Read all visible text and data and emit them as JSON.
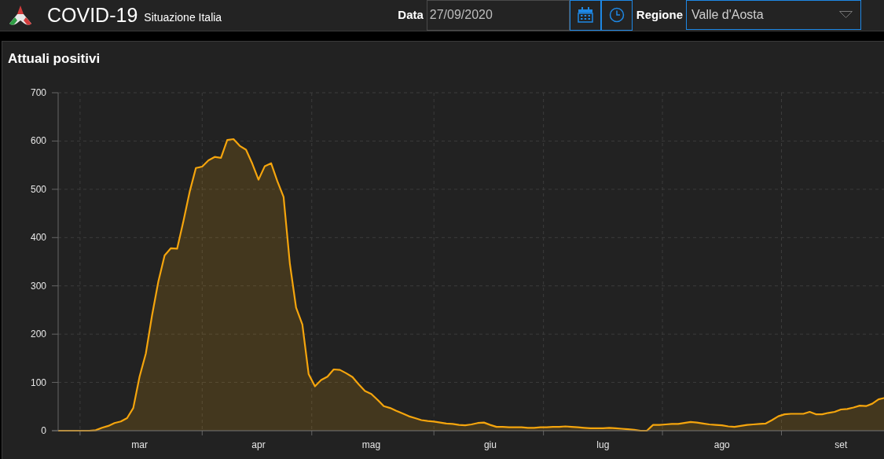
{
  "header": {
    "title": "COVID-19",
    "subtitle": "Situazione Italia"
  },
  "filters": {
    "date_label": "Data",
    "date_value": "27/09/2020",
    "region_label": "Regione",
    "region_value": "Valle d'Aosta"
  },
  "panel": {
    "title": "Attuali positivi",
    "chart_data": {
      "type": "area",
      "categories": [
        null,
        null,
        null,
        null,
        null,
        null,
        null,
        null,
        null,
        null,
        null,
        null,
        null,
        "mar",
        null,
        null,
        null,
        null,
        null,
        null,
        null,
        null,
        null,
        null,
        null,
        null,
        null,
        null,
        null,
        null,
        null,
        null,
        "apr",
        null,
        null,
        null,
        null,
        null,
        null,
        null,
        null,
        null,
        null,
        null,
        null,
        null,
        null,
        null,
        null,
        null,
        "mag",
        null,
        null,
        null,
        null,
        null,
        null,
        null,
        null,
        null,
        null,
        null,
        null,
        null,
        null,
        null,
        null,
        null,
        null,
        "giu",
        null,
        null,
        null,
        null,
        null,
        null,
        null,
        null,
        null,
        null,
        null,
        null,
        null,
        null,
        null,
        null,
        null,
        "lug",
        null,
        null,
        null,
        null,
        null,
        null,
        null,
        null,
        null,
        null,
        null,
        null,
        null,
        null,
        null,
        null,
        null,
        null,
        "ago",
        null,
        null,
        null,
        null,
        null,
        null,
        null,
        null,
        null,
        null,
        null,
        null,
        null,
        null,
        null,
        null,
        null,
        null,
        "set",
        null,
        null,
        null,
        null,
        null,
        null,
        null
      ],
      "series": [
        {
          "color": "#f5a50d",
          "values": [
            0,
            0,
            0,
            0,
            0,
            0,
            1,
            6,
            10,
            16,
            19,
            26,
            47,
            112,
            160,
            239,
            309,
            363,
            378,
            377,
            434,
            495,
            544,
            547,
            560,
            567,
            565,
            602,
            604,
            590,
            582,
            553,
            520,
            548,
            554,
            517,
            484,
            346,
            255,
            220,
            117,
            92,
            105,
            112,
            127,
            126,
            119,
            111,
            96,
            82,
            76,
            64,
            51,
            47,
            41,
            36,
            30,
            26,
            22,
            20,
            19,
            17,
            15,
            14,
            12,
            11,
            13,
            16,
            17,
            12,
            8,
            8,
            7,
            7,
            7,
            6,
            6,
            7,
            7,
            8,
            8,
            9,
            8,
            7,
            6,
            5,
            5,
            5,
            6,
            5,
            4,
            3,
            2,
            0,
            0,
            12,
            12,
            13,
            14,
            14,
            16,
            18,
            17,
            15,
            13,
            12,
            11,
            9,
            8,
            10,
            12,
            13,
            14,
            15,
            22,
            30,
            34,
            35,
            35,
            35,
            39,
            34,
            34,
            37,
            39,
            44,
            45,
            48,
            52,
            51,
            56,
            65,
            68
          ]
        }
      ],
      "ylim": [
        0,
        700
      ],
      "yticks": [
        0,
        100,
        200,
        300,
        400,
        500,
        600,
        700
      ],
      "grid": true
    }
  }
}
